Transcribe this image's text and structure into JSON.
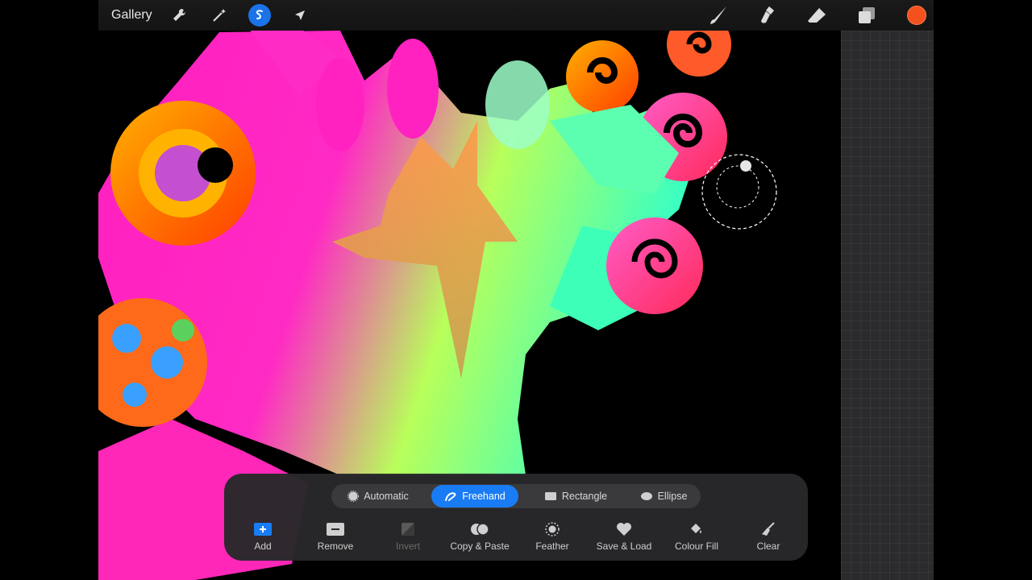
{
  "topbar": {
    "gallery_label": "Gallery",
    "icons": [
      "wrench-icon",
      "magic-wand-icon",
      "selection-icon",
      "arrow-cursor-icon",
      "brush-icon",
      "smudge-icon",
      "eraser-icon",
      "layers-icon"
    ],
    "current_color": "#f4511e",
    "selection_accent": "#1a73e8"
  },
  "selection_toolbar": {
    "modes": [
      {
        "label": "Automatic",
        "active": false
      },
      {
        "label": "Freehand",
        "active": true
      },
      {
        "label": "Rectangle",
        "active": false
      },
      {
        "label": "Ellipse",
        "active": false
      }
    ],
    "actions": [
      {
        "label": "Add",
        "enabled": true
      },
      {
        "label": "Remove",
        "enabled": true
      },
      {
        "label": "Invert",
        "enabled": false
      },
      {
        "label": "Copy & Paste",
        "enabled": true
      },
      {
        "label": "Feather",
        "enabled": true
      },
      {
        "label": "Save & Load",
        "enabled": true
      },
      {
        "label": "Colour Fill",
        "enabled": true
      },
      {
        "label": "Clear",
        "enabled": true
      }
    ],
    "active_color": "#1a7cf4"
  }
}
